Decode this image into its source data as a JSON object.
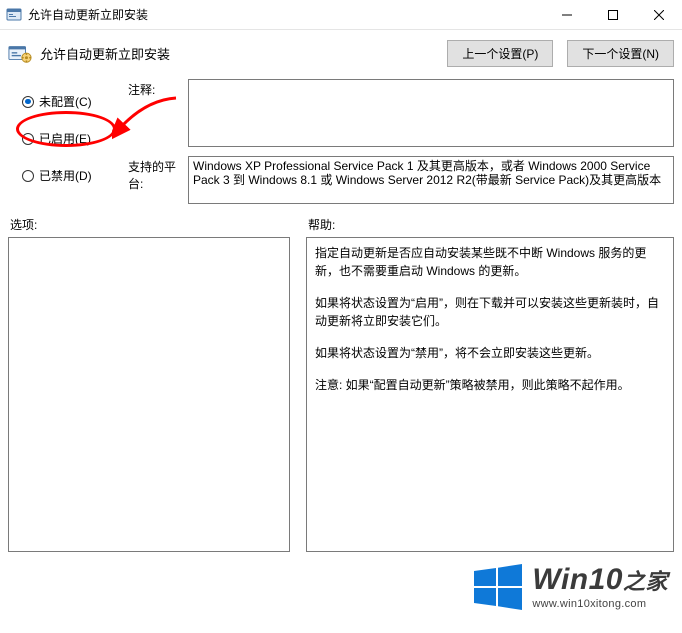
{
  "window": {
    "title": "允许自动更新立即安装",
    "controls": {
      "minimize": "—",
      "maximize": "☐",
      "close": "✕"
    }
  },
  "header": {
    "title": "允许自动更新立即安装",
    "prev_setting": "上一个设置(P)",
    "next_setting": "下一个设置(N)"
  },
  "radios": {
    "not_configured": "未配置(C)",
    "enabled": "已启用(E)",
    "disabled": "已禁用(D)"
  },
  "labels": {
    "comment": "注释:",
    "supported": "支持的平台:",
    "options": "选项:",
    "help": "帮助:"
  },
  "supported_text": "Windows XP Professional Service Pack 1 及其更高版本，或者 Windows 2000 Service Pack 3 到 Windows 8.1 或 Windows Server 2012 R2(带最新 Service Pack)及其更高版本",
  "help_paras": {
    "p1": "指定自动更新是否应自动安装某些既不中断 Windows 服务的更新，也不需要重启动 Windows 的更新。",
    "p2": "如果将状态设置为“启用”，则在下载并可以安装这些更新装时，自动更新将立即安装它们。",
    "p3": "如果将状态设置为“禁用”，将不会立即安装这些更新。",
    "p4": "注意: 如果“配置自动更新”策略被禁用，则此策略不起作用。"
  },
  "watermark": {
    "brand": "Win10",
    "suffix": "之家",
    "url": "www.win10xitong.com"
  },
  "colors": {
    "accent": "#0066cc",
    "annotation": "#ff0000",
    "logo": "#0f79d8"
  }
}
